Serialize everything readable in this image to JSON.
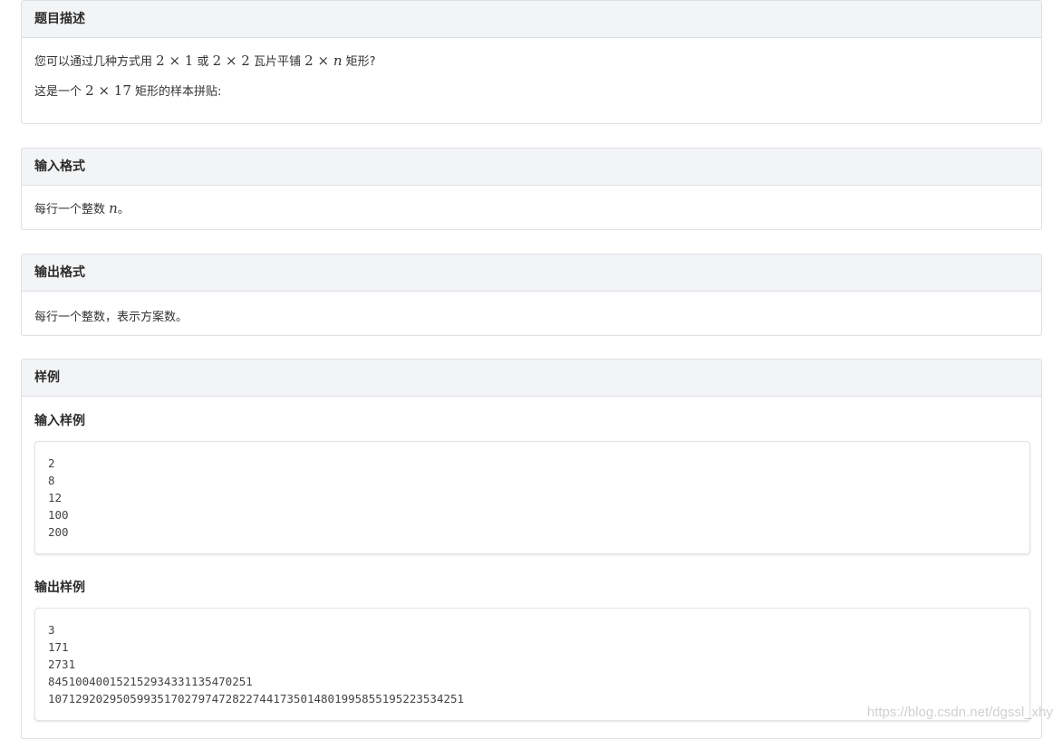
{
  "description": {
    "title": "题目描述",
    "line1_prefix": "您可以通过几种方式用",
    "line1_tile1": "2 × 1",
    "line1_or": "或",
    "line1_tile2": "2 × 2",
    "line1_mid": "瓦片平铺",
    "line1_rect_num": "2 ×",
    "line1_rect_var": "n",
    "line1_suffix": "矩形?",
    "line2_prefix": "这是一个",
    "line2_rect": "2 × 17",
    "line2_suffix": "矩形的样本拼贴:"
  },
  "input_format": {
    "title": "输入格式",
    "text_prefix": "每行一个整数",
    "text_var": "n",
    "text_suffix": "。"
  },
  "output_format": {
    "title": "输出格式",
    "text": "每行一个整数，表示方案数。"
  },
  "samples": {
    "title": "样例",
    "input_title": "输入样例",
    "input_lines": [
      "2",
      "8",
      "12",
      "100",
      "200"
    ],
    "output_title": "输出样例",
    "output_lines": [
      "3",
      "171",
      "2731",
      "845100400152152934331135470251",
      "1071292029505993517027974728227441735014801995855195223534251"
    ]
  },
  "watermark": "https://blog.csdn.net/dgssl_xhy"
}
